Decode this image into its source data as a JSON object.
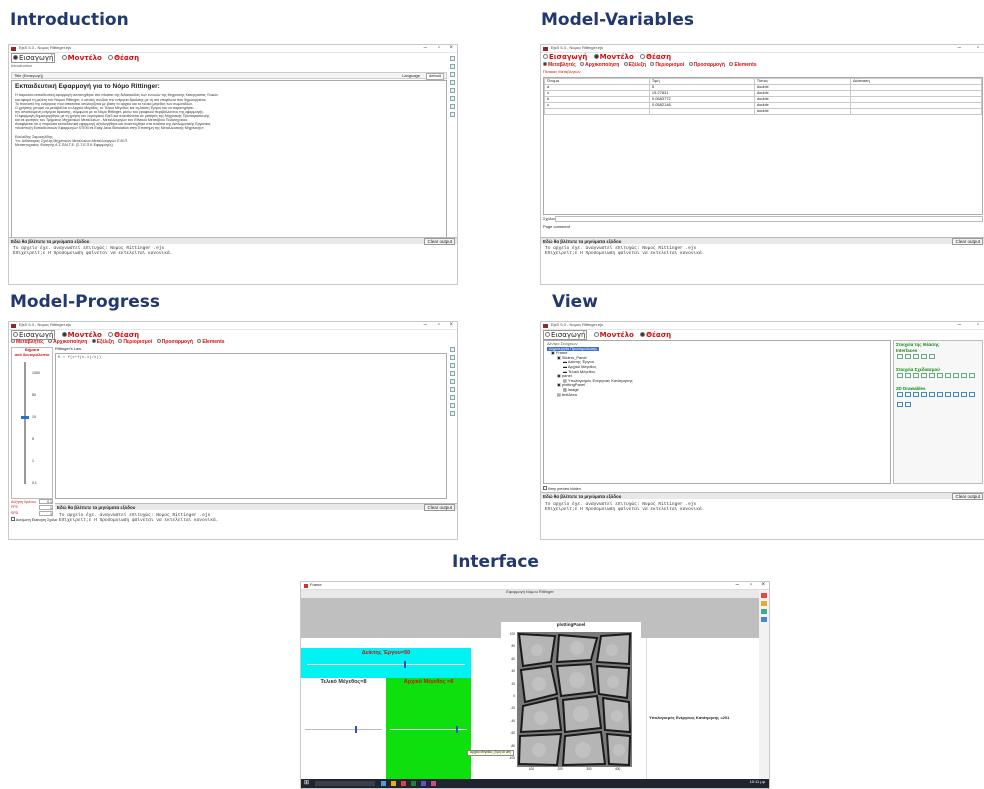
{
  "sections": {
    "introduction": "Introduction",
    "model_variables": "Model-Variables",
    "model_progress": "Model-Progress",
    "view": "View",
    "interface": "Interface"
  },
  "ejs": {
    "window_title": "EjsS 5.3 - Νομος Rittinger.ejs",
    "tabs": [
      "Εισαγωγή",
      "Μοντέλο",
      "Θέαση"
    ],
    "model_subtabs": [
      "Μεταβλητές",
      "Αρχικοποίηση",
      "Εξέλιξη",
      "Περιορισμοί",
      "Προσαρμογή",
      "Elements"
    ],
    "output_label": "Εδώ θα βλέπετε τα μηνύματα εξόδου",
    "clear_output": "Clear output",
    "output_lines": [
      "Το αρχείο έχε. αναγνωστεί επιτυχώς: Νομος Rittinger .ejs",
      "Επιχειρείτ;ε Η προσομοιωση φαίνεται να εκτελείται κανονικά."
    ]
  },
  "intro": {
    "file_label": "Introduction",
    "page_tab": "Title (Εισαγωγή)",
    "language_label": "Language",
    "language_value": "default",
    "heading": "Εκπαιδευτική Εφαρμογή για το Νόμο Rittinger:",
    "body_lines": [
      "Η παρούσα εκπαιδευτική εφαρμογή αναπτύχθηκε στο πλαίσιο της διδασκαλίας των εννοιών της Μηχανικής Κατεργασίας Υλικών",
      "και αφορά τη μελέτη του Νόμου Rittinger, ο οποίος συνδέει την ενέργεια θραύσης με τη νέα επιφάνεια που δημιουργείται.",
      "Το ποσοστό της ενέργειας που απαιτείται υπολογίζεται με βάση το αρχικό και το τελικό μέγεθος των σωματιδίων.",
      "Ο χρήστης μπορεί να μεταβάλλει το Αρχικό Μέγεθος, το Τελικό Μέγεθος και τη Δείκτη Έργου και να παρατηρήσει",
      "την απαιτούμενη ενέργεια θραύσης, σύμφωνα με το Νόμο Rittinger, μέσω του γραφικού περιβάλλοντος της εφαρμογής.",
      "Η εφαρμογή δημιουργήθηκε με τη χρήση του λογισμικού EjsS και απευθύνεται σε μαθητές της Μηχανικής Προπαρασκευής",
      "και σε φοιτητές του Τμήματος Μηχανικών Μεταλλείων - Μεταλλουργών του Εθνικού Μετσόβιου Πολυτεχνείου.",
      "Αναφέρεται ότι η παρούσα εκπαιδευτική εφαρμογή αξιολογήθηκε και αναπτύχθηκε στα πλαίσια της Διπλωματικής Εργασίας",
      "«Ανάπτυξη Εκπαιδευτικών Εφαρμογών STEM σε Easy Java Simulation στην Επιστήμη της Μεταλλευτικής Μηχανικής»."
    ],
    "author_lines": [
      "Ευκλείδης Σαμουηλίδης",
      "Υπ. Διδάκτορας Σχολής Μηχανικών Μεταλλείων-Μεταλλουργών Ε.Μ.Π.",
      "Μεταπτυχιακός Φοιτητής Α.Σ.ΠΑΙ.Τ.Ε. (Σ.Τ.Ε.Π.Κ Εφαρμογές)"
    ]
  },
  "variables": {
    "page_tab": "Πίνακας Μεταβλητών",
    "headers": [
      "Όνομα",
      "Τιμή",
      "Τύπος",
      "Διάσταση"
    ],
    "rows": [
      [
        "a",
        "5",
        "double",
        ""
      ],
      [
        "x",
        "15.27831",
        "double",
        ""
      ],
      [
        "b",
        "0.0583772",
        "double",
        ""
      ],
      [
        "c",
        "0.0582148",
        "double",
        ""
      ],
      [
        "",
        "",
        "double",
        ""
      ]
    ],
    "comment_label": "Σχόλιο",
    "page_comment_label": "Page comment"
  },
  "progress": {
    "page_tab": "Rittinger's Law",
    "steps_label": "Βήματα",
    "steps_sub": "ανά δευτερόλεπτο",
    "slider_ticks": [
      "1000",
      "50",
      "10",
      "5",
      "1",
      "0.1"
    ],
    "code_line": "K = f(x*f(x-1)/x))",
    "increment_label": "Αύξηση Χρόνου",
    "increment_value": "0.1",
    "fps_label": "FPS",
    "fps_value": "1",
    "spd_label": "SPD",
    "spd_value": "1",
    "autostart_label": "Αυτόματη Εκκίνηση",
    "comment_label": "Σχόλιο"
  },
  "view_tree": {
    "header": "Δέντρο Στοιχείων",
    "nodes": [
      "Δημιουργία Προσομοίωσης",
      "Frame",
      "Sliders_Panel",
      "Δείκτης Έργου",
      "Αρχικό Μέγεθος",
      "Τελικό Μέγεθος",
      "panel",
      "Υπολογισμός Ενέργειας Κατάτμησης",
      "plottingPanel",
      "image",
      "textArea"
    ],
    "keep_hidden": "Keep preview hidden",
    "right_sections": [
      "Στοιχεία της Θέασης",
      "Interfaces",
      "Στοιχεία Σχεδιασμού",
      "2D Drawables"
    ]
  },
  "app_window": {
    "title": "Frame",
    "subtitle": "Εφαρμογή Νόμου Rittinger",
    "slider1": "Δείκτης Έργου=50",
    "slider2": "Τελικό Μέγεθος=8",
    "slider3": "Αρχικό Μέγεθος =8",
    "plot_title": "plottingPanel",
    "y_ticks": [
      "100",
      "80",
      "60",
      "40",
      "20",
      "0",
      "-20",
      "-40",
      "-60",
      "-80",
      "-100"
    ],
    "x_ticks": [
      "100",
      "200",
      "300",
      "400"
    ],
    "result_text": "Υπολογισμός Ενέργειας Κατάτμησης =201",
    "tooltip": "Αρχικό Μέγεθος (Τιμή σε cm)",
    "taskbar_time": "10:11 μμ"
  },
  "colors": {
    "heading_blue": "#21396e",
    "cyan": "#00f2f2",
    "green": "#0de00d",
    "accent_red": "#d01010"
  }
}
